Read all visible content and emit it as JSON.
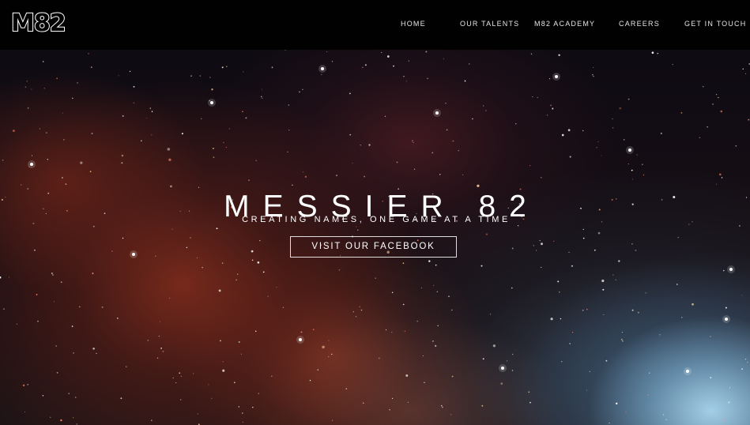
{
  "brand": {
    "logo_text": "M82"
  },
  "nav": {
    "items": [
      {
        "label": "HOME"
      },
      {
        "label": "OUR TALENTS"
      },
      {
        "label": "M82 ACADEMY"
      },
      {
        "label": "CAREERS"
      },
      {
        "label": "GET IN TOUCH"
      }
    ]
  },
  "hero": {
    "title": "MESSIER 82",
    "subtitle": "CREATING NAMES, ONE GAME AT A TIME",
    "cta_label": "VISIT OUR FACEBOOK"
  },
  "colors": {
    "nav_background": "#000000",
    "text": "#ffffff",
    "nebula_red": "#963220",
    "galaxy_blue": "#aad7f0"
  }
}
